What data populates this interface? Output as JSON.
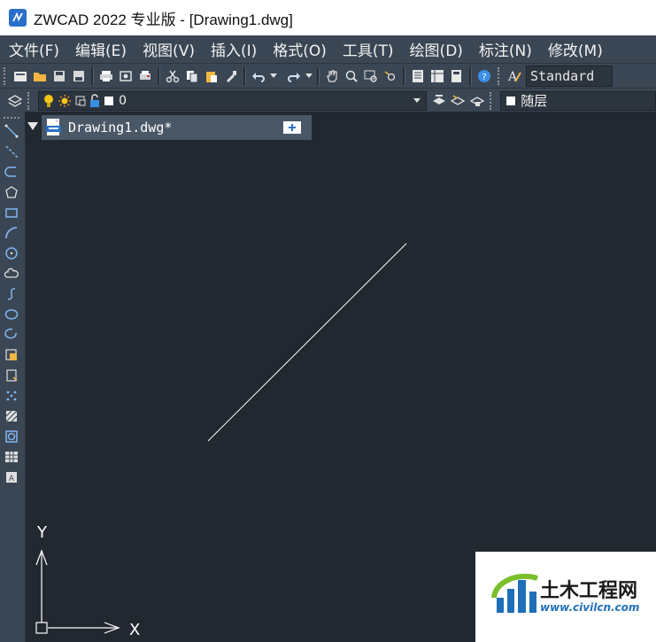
{
  "window": {
    "title": "ZWCAD 2022 专业版 - [Drawing1.dwg]"
  },
  "menu": [
    {
      "label": "文件(F)"
    },
    {
      "label": "编辑(E)"
    },
    {
      "label": "视图(V)"
    },
    {
      "label": "插入(I)"
    },
    {
      "label": "格式(O)"
    },
    {
      "label": "工具(T)"
    },
    {
      "label": "绘图(D)"
    },
    {
      "label": "标注(N)"
    },
    {
      "label": "修改(M)"
    }
  ],
  "toolbar": {
    "text_style": "Standard"
  },
  "layer": {
    "current": "0",
    "color": "随层"
  },
  "tab": {
    "label": "Drawing1.dwg*"
  },
  "ucs": {
    "x_label": "X",
    "y_label": "Y"
  },
  "watermark": {
    "title": "土木工程网",
    "url": "www.civilcn.com"
  },
  "colors": {
    "canvas": "#212830",
    "chrome": "#3b4654",
    "tab_active": "#4a5767",
    "line": "#ffffff"
  }
}
